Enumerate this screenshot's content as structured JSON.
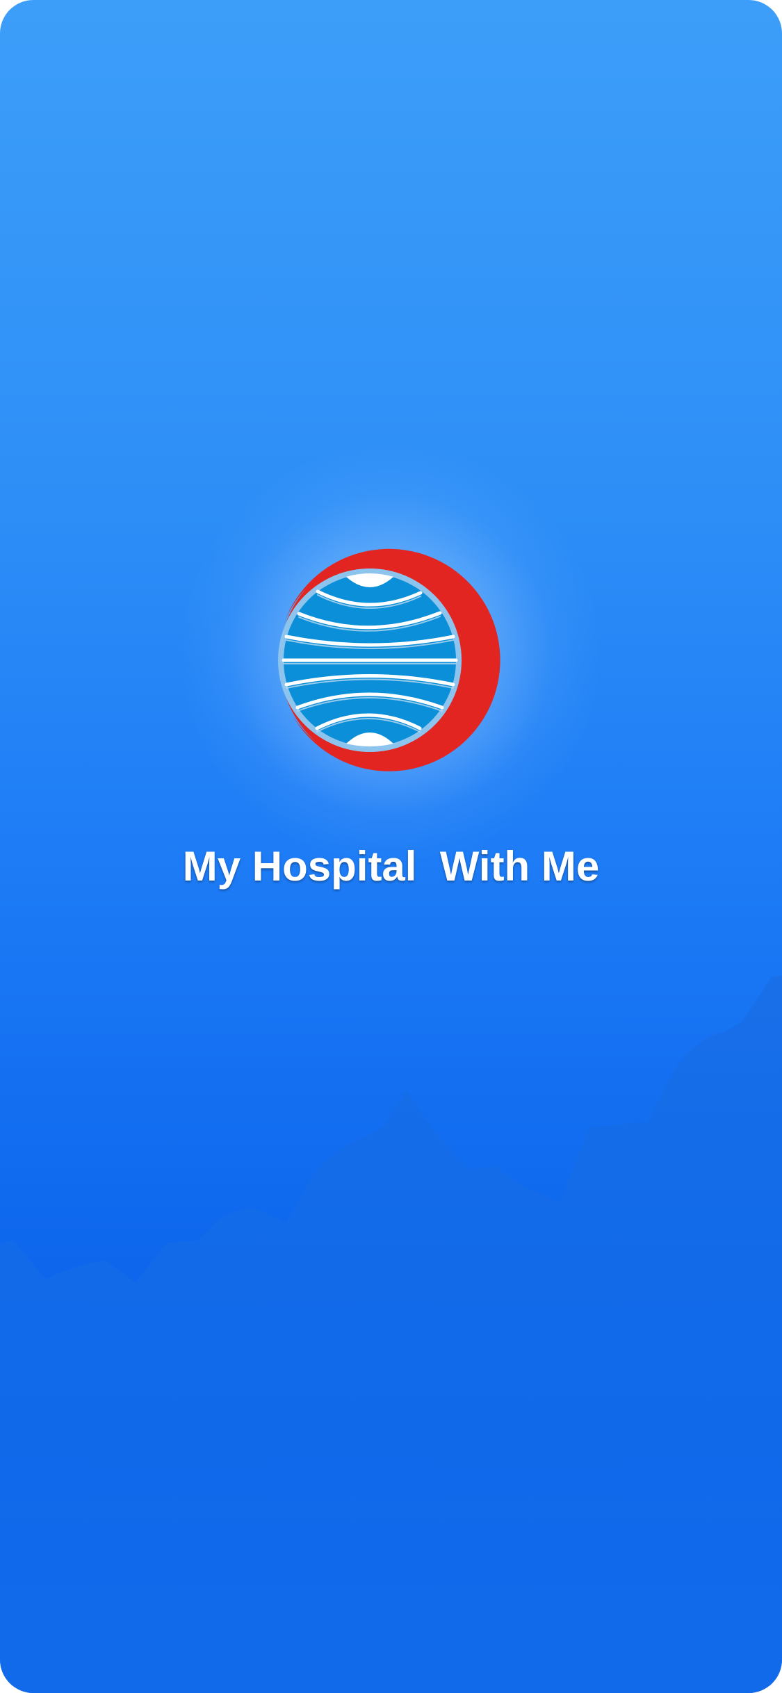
{
  "app": {
    "title": "My Hospital  With Me"
  },
  "logo": {
    "icon": "globe-crescent-logo-icon",
    "colors": {
      "crescent": "#e32521",
      "globe": "#0a8fd8",
      "ring": "#8cc4ee",
      "lines": "#ffffff"
    }
  },
  "background": {
    "gradient_top": "#3d9ef9",
    "gradient_bottom": "#035aea",
    "mountain_color": "#0d5fe0"
  }
}
